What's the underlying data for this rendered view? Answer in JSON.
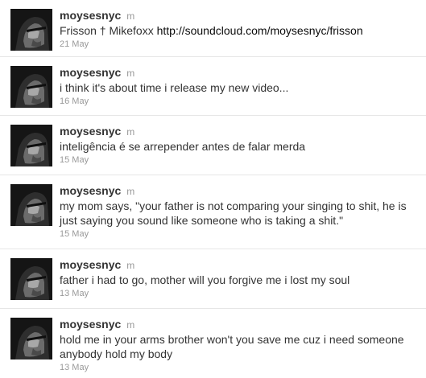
{
  "tweets": [
    {
      "username": "moysesnyc",
      "realname": "m",
      "text": "Frisson † Mikefoxx ",
      "link": "http://soundcloud.com/moysesnyc/frisson",
      "date": "21 May"
    },
    {
      "username": "moysesnyc",
      "realname": "m",
      "text": "i think it's about time i release my new video...",
      "date": "16 May"
    },
    {
      "username": "moysesnyc",
      "realname": "m",
      "text": "inteligência é se arrepender antes de falar merda",
      "date": "15 May"
    },
    {
      "username": "moysesnyc",
      "realname": "m",
      "text": "my mom says, \"your father is not comparing your singing to shit, he is just saying you sound like someone who is taking a shit.\"",
      "date": "15 May"
    },
    {
      "username": "moysesnyc",
      "realname": "m",
      "text": "father i had to go, mother will you forgive me i lost my soul",
      "date": "13 May"
    },
    {
      "username": "moysesnyc",
      "realname": "m",
      "text": "hold me in your arms brother won't you save me cuz i need someone anybody hold my body",
      "date": "13 May"
    }
  ]
}
